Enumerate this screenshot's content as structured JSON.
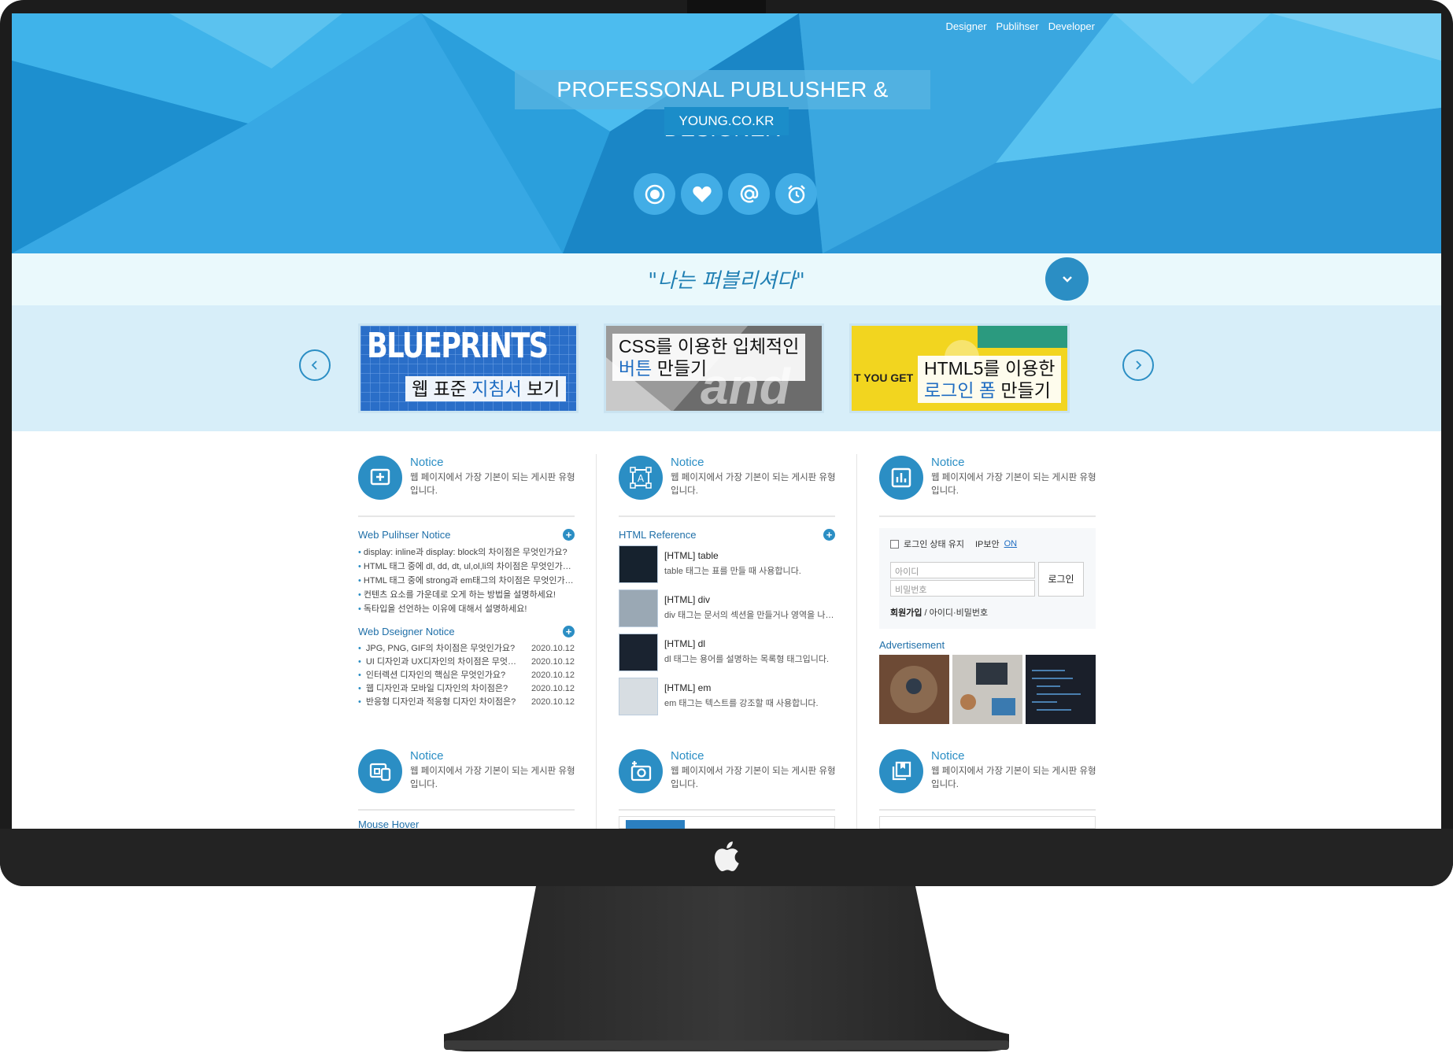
{
  "topnav": [
    "Designer",
    "Publihser",
    "Developer"
  ],
  "hero": {
    "title": "PROFESSONAL PUBLUSHER & DESIGNER",
    "subtitle": "YOUNG.CO.KR",
    "icons": [
      "record-icon",
      "heart-icon",
      "at-icon",
      "alarm-icon"
    ]
  },
  "quote": "\"나는 퍼블리셔다\"",
  "slides": [
    {
      "headline": "BLUEPRINTS",
      "caption_plain": "웹 표준 ",
      "caption_blue": "지침서",
      "caption_end": " 보기"
    },
    {
      "line1": "CSS를 이용한 입체적인",
      "line2_blue": "버튼",
      "line2_end": " 만들기",
      "bg_text": "and inte"
    },
    {
      "badge": "T YOU GET",
      "line1": "HTML5를 이용한",
      "line2_blue": "로그인 폼",
      "line2_end": " 만들기"
    }
  ],
  "notice": {
    "title": "Notice",
    "desc": "웹 페이지에서 가장 기본이 되는 게시판 유형입니다."
  },
  "col1": {
    "section1": {
      "title": "Web Pulihser Notice",
      "items": [
        "display: inline과 display: block의 차이점은 무엇인가요?",
        "HTML 태그 중에 dl, dd, dt, ul,ol,li의 차이점은 무엇인가요?",
        "HTML 태그 중에 strong과 em태그의 차이점은 무엇인가요?",
        "컨텐츠 요소를 가운데로 오게 하는 방법을 설명하세요!",
        "독타입을 선언하는 이유에 대해서 설명하세요!"
      ]
    },
    "section2": {
      "title": "Web Dseigner Notice",
      "items": [
        {
          "t": "JPG, PNG, GIF의 차이점은 무엇인가요?",
          "d": "2020.10.12"
        },
        {
          "t": "UI 디자인과 UX디자인의 차이점은 무엇인가요?",
          "d": "2020.10.12"
        },
        {
          "t": "인터렉션 디자인의 핵심은 무엇인가요?",
          "d": "2020.10.12"
        },
        {
          "t": "웹 디자인과 모바일 디자인의 차이점은?",
          "d": "2020.10.12"
        },
        {
          "t": "반응형 디자인과 적응형 디자인 차이점은?",
          "d": "2020.10.12"
        }
      ]
    }
  },
  "col2": {
    "section_title": "HTML Reference",
    "items": [
      {
        "title": "[HTML] table",
        "desc": "table 태그는 표를 만들 때 사용합니다."
      },
      {
        "title": "[HTML] div",
        "desc": "div 태그는 문서의 섹션을 만들거나 영역을 나눌 때 사용합니다."
      },
      {
        "title": "[HTML] dl",
        "desc": "dl 태그는 용어를 설명하는 목록형 태그입니다."
      },
      {
        "title": "[HTML] em",
        "desc": "em 태그는 텍스트를 강조할 때 사용합니다."
      }
    ]
  },
  "col3": {
    "login": {
      "keep": "로그인 상태 유지",
      "ip": "IP보안",
      "ip_on": "ON",
      "id_placeholder": "아이디",
      "pw_placeholder": "비밀번호",
      "button": "로그인",
      "join": "회원가입",
      "find": " / 아이디·비밀번호"
    },
    "ad_title": "Advertisement"
  },
  "row2": {
    "mouse_hover": "Mouse Hover"
  },
  "colors": {
    "accent": "#2b8ec4",
    "hero": "#2b9fdc",
    "quote_bg": "#eaf9fc",
    "slider_bg": "#d7eef9"
  }
}
